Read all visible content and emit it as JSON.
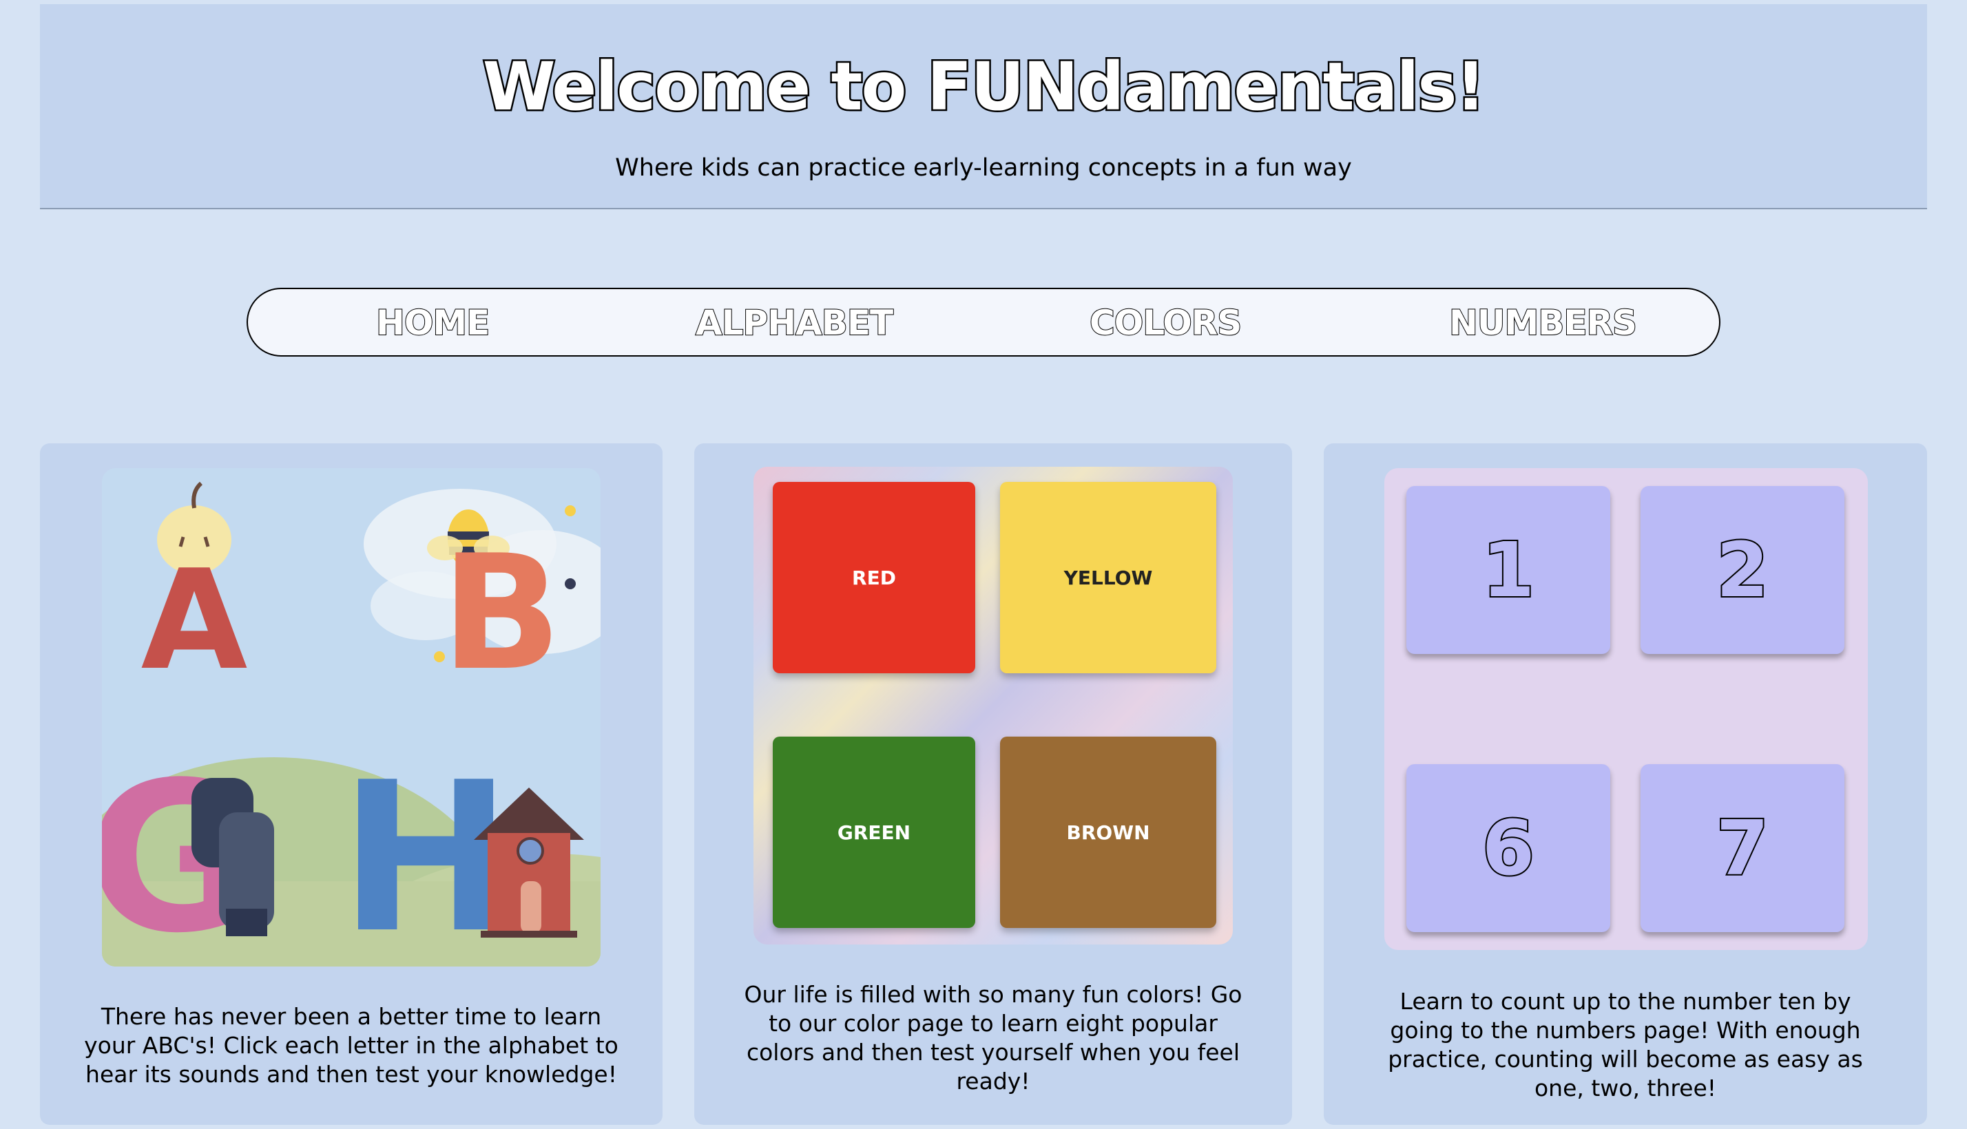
{
  "header": {
    "title": "Welcome to FUNdamentals!",
    "subtitle": "Where kids can practice early-learning concepts in a fun way"
  },
  "nav": {
    "items": [
      "HOME",
      "ALPHABET",
      "COLORS",
      "NUMBERS"
    ]
  },
  "cards": {
    "alphabet": {
      "letters": [
        "A",
        "B",
        "G",
        "H"
      ],
      "text": "There has never been a better time to learn your ABC's! Click each letter in the alphabet to hear its sounds and then test your knowledge!"
    },
    "colors": {
      "tiles": [
        "RED",
        "YELLOW",
        "GREEN",
        "BROWN"
      ],
      "tile_colors": [
        "#e63324",
        "#f7d654",
        "#3a7f24",
        "#9a6b34"
      ],
      "text": "Our life is filled with so many fun colors! Go to our color page to learn eight popular colors and then test yourself when you feel ready!"
    },
    "numbers": {
      "tiles": [
        "1",
        "2",
        "6",
        "7"
      ],
      "text": "Learn to count up to the number ten by going to the numbers page! With enough practice, counting will become as easy as one, two, three!"
    }
  }
}
